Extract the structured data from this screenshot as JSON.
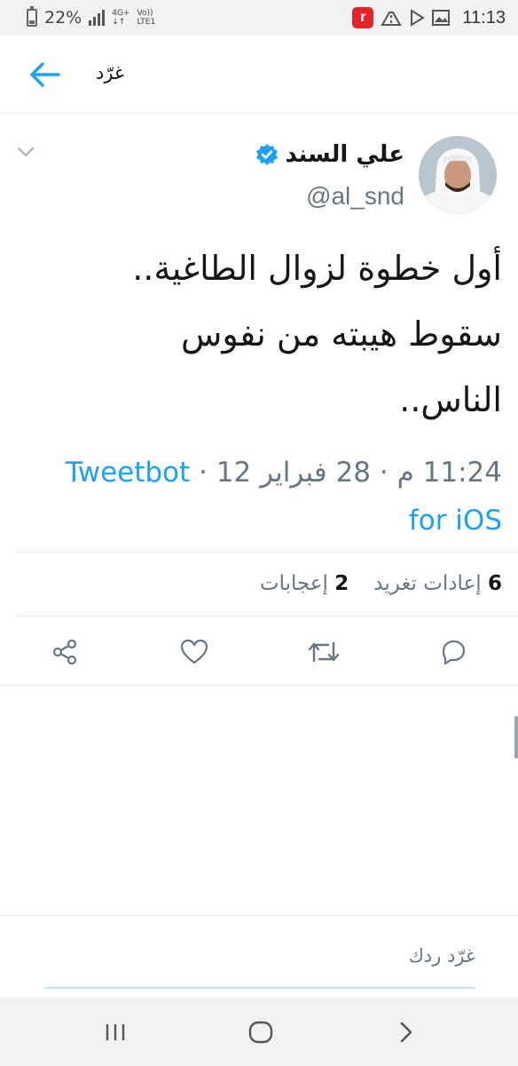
{
  "status_bar": {
    "battery": "22%",
    "network_top": "4G+",
    "network_bottom": "LTE1",
    "volte_top": "Vo))",
    "app_badge": "r",
    "time": "11:13"
  },
  "header": {
    "title": "غرّد",
    "back_icon": "arrow-left-icon"
  },
  "tweet": {
    "author_name": "علي السند",
    "handle": "@al_snd",
    "verified": true,
    "text_lines": [
      "أول خطوة لزوال الطاغية..",
      "سقوط هيبته من نفوس",
      "الناس.."
    ],
    "time": "11:24 م",
    "date": "28 فبراير 12",
    "source_line1": "Tweetbot",
    "source_line2": "for iOS",
    "retweets_count": "6",
    "retweets_label": "إعادات تغريد",
    "likes_count": "2",
    "likes_label": "إعجابات",
    "sep": "·"
  },
  "actions": {
    "reply_icon": "reply-icon",
    "retweet_icon": "retweet-icon",
    "like_icon": "heart-icon",
    "share_icon": "share-icon"
  },
  "reply": {
    "placeholder": "غرّد ردك"
  },
  "colors": {
    "accent": "#1da1f2",
    "secondary_text": "#657786",
    "primary_text": "#14171a",
    "divider": "#e6ecf0"
  }
}
